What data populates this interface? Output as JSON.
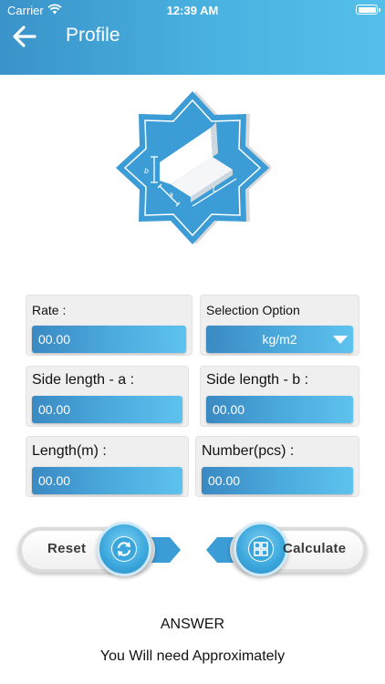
{
  "status": {
    "carrier": "Carrier",
    "time": "12:39 AM"
  },
  "header": {
    "title": "Profile"
  },
  "form": {
    "rate": {
      "label": "Rate :",
      "value": "00.00"
    },
    "selection": {
      "label": "Selection Option",
      "value": "kg/m2"
    },
    "side_a": {
      "label": "Side length - a :",
      "value": "00.00"
    },
    "side_b": {
      "label": "Side length - b :",
      "value": "00.00"
    },
    "length": {
      "label": "Length(m) :",
      "value": "00.00"
    },
    "number": {
      "label": "Number(pcs) :",
      "value": "00.00"
    }
  },
  "buttons": {
    "reset": "Reset",
    "calculate": "Calculate"
  },
  "answer": {
    "title": "ANSWER",
    "text": "You Will need Approximately"
  },
  "colors": {
    "header_start": "#3a93c9",
    "header_end": "#54c0ea",
    "field": "#4ba9dc"
  },
  "icons": {
    "back": "back-arrow-icon",
    "wifi": "wifi-icon",
    "battery": "battery-icon",
    "refresh": "refresh-icon",
    "calculator": "calculator-icon",
    "logo": "profile-logo-icon"
  }
}
